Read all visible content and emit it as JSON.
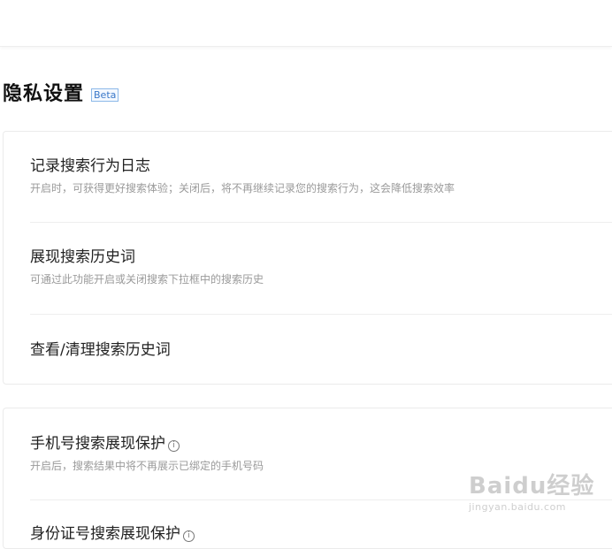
{
  "page": {
    "title": "隐私设置",
    "badge": "Beta"
  },
  "group1": {
    "items": [
      {
        "title": "记录搜索行为日志",
        "desc": "开启时，可获得更好搜索体验；关闭后，将不再继续记录您的搜索行为，这会降低搜索效率"
      },
      {
        "title": "展现搜索历史词",
        "desc": "可通过此功能开启或关闭搜索下拉框中的搜索历史"
      },
      {
        "title": "查看/清理搜索历史词"
      }
    ]
  },
  "group2": {
    "items": [
      {
        "title": "手机号搜索展现保护",
        "desc": "开启后，搜索结果中将不再展示已绑定的手机号码",
        "icon": "info-icon"
      },
      {
        "title": "身份证号搜索展现保护",
        "icon": "info-icon"
      }
    ]
  },
  "watermark": {
    "logo": "Baidu经验",
    "url": "jingyan.baidu.com"
  }
}
